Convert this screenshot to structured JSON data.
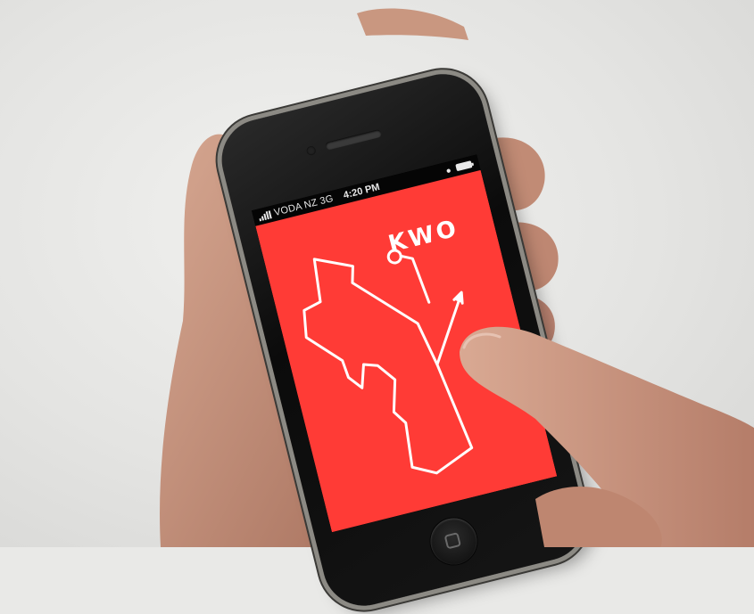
{
  "status_bar": {
    "carrier": "VODA NZ  3G",
    "time": "4:20 PM"
  },
  "app": {
    "code_label": "KWO"
  },
  "colors": {
    "screen_background": "#ff3b36",
    "route_line": "#ffffff",
    "backdrop": "#e9e9e7",
    "skin": "#c99780"
  },
  "icons": [
    "signal-bars-icon",
    "lock-icon",
    "battery-icon",
    "home-button-icon",
    "route-arrow-icon",
    "location-pin-icon"
  ]
}
